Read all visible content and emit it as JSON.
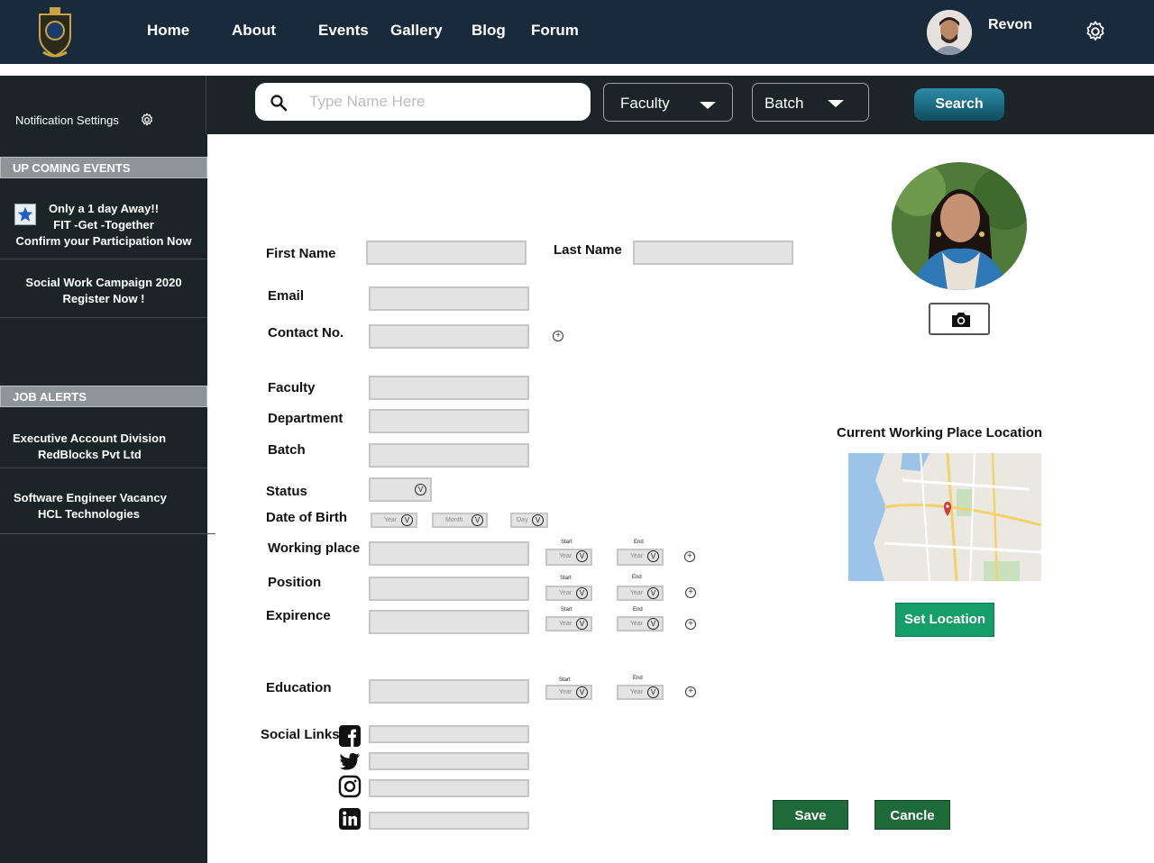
{
  "nav": {
    "links": [
      "Home",
      "About",
      "Events",
      "Gallery",
      "Blog",
      "Forum"
    ],
    "username": "Revon",
    "icons": {
      "logo": "crest-logo-icon",
      "settings": "gear-icon"
    }
  },
  "filter": {
    "notification_label": "Notification Settings",
    "search_placeholder": "Type Name Here",
    "faculty_label": "Faculty",
    "batch_label": "Batch",
    "search_button": "Search"
  },
  "sidebar": {
    "events_heading": "UP COMING EVENTS",
    "events": [
      {
        "lines": [
          "Only a 1 day Away!!",
          "FIT -Get -Together",
          "Confirm your Participation Now"
        ]
      },
      {
        "lines": [
          "Social Work Campaign 2020",
          "Register Now !"
        ]
      }
    ],
    "jobs_heading": "JOB ALERTS",
    "jobs": [
      {
        "lines": [
          "Executive Account Division",
          "RedBlocks Pvt Ltd"
        ]
      },
      {
        "lines": [
          "Software Engineer Vacancy",
          "HCL Technologies"
        ]
      }
    ]
  },
  "form": {
    "first_name": "First Name",
    "last_name": "Last Name",
    "email": "Email",
    "contact": "Contact No.",
    "faculty": "Faculty",
    "department": "Department",
    "batch": "Batch",
    "status": "Status",
    "dob": "Date of Birth",
    "dob_year": "Year",
    "dob_month": "Month",
    "dob_day": "Day",
    "working_place": "Working place",
    "position": "Position",
    "experience": "Expirence",
    "education": "Education",
    "social_links": "Social Links",
    "start": "Start",
    "end": "End",
    "year": "Year",
    "dropdown_glyph": "V",
    "add_glyph": "+"
  },
  "right": {
    "location_title": "Current Working Place Location",
    "set_location": "Set Location",
    "save": "Save",
    "cancel": "Cancle"
  },
  "colors": {
    "nav_bg": "#182a3c",
    "dark_bg": "#1b2427",
    "green_button": "#1e6b39",
    "location_button": "#159e67"
  }
}
